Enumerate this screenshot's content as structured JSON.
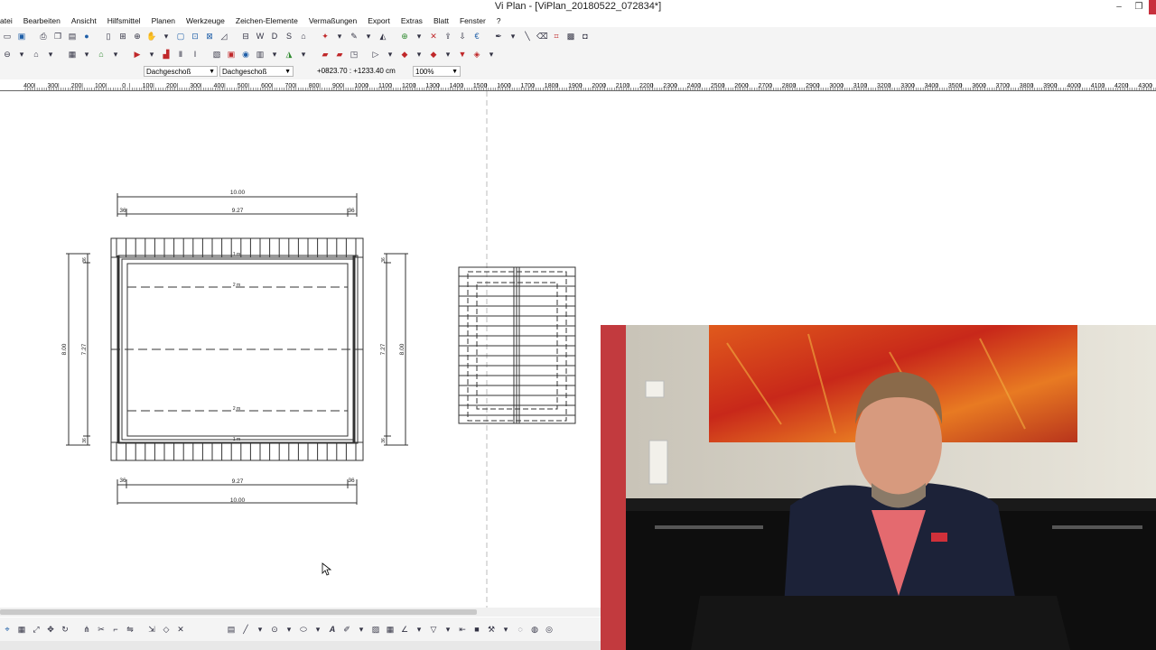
{
  "window": {
    "title": "Vi Plan - [ViPlan_20180522_072834*]",
    "minimize": "–",
    "restore": "❐",
    "close": "×"
  },
  "menu": [
    "atei",
    "Bearbeiten",
    "Ansicht",
    "Hilfsmittel",
    "Planen",
    "Werkzeuge",
    "Zeichen-Elemente",
    "Vermaßungen",
    "Export",
    "Extras",
    "Blatt",
    "Fenster",
    "?"
  ],
  "options": {
    "floor1": "Dachgeschoß",
    "floor2": "Dachgeschoß",
    "coordinates": "+0823.70 : +1233.40 cm",
    "zoom": "100%"
  },
  "ruler": {
    "labels": [
      "400",
      "300",
      "200",
      "100",
      "0",
      "100",
      "200",
      "300",
      "400",
      "500",
      "600",
      "700",
      "800",
      "900",
      "1000",
      "1100",
      "1200",
      "1300",
      "1400",
      "1500",
      "1600",
      "1700",
      "1800",
      "1900",
      "2000",
      "2100",
      "2200",
      "2300",
      "2400",
      "2500",
      "2600",
      "2700",
      "2800",
      "2900",
      "3000",
      "3100",
      "3200",
      "3300",
      "3400",
      "3500",
      "3600",
      "3700",
      "3800",
      "3900",
      "4000",
      "4100",
      "4200",
      "4300"
    ]
  },
  "drawing": {
    "top_dim_total": "10.00",
    "top_dim_inner": "9.27",
    "top_dim_left_small": "36",
    "top_dim_right_small": "36",
    "bottom_dim_inner": "9.27",
    "bottom_dim_total": "10.00",
    "bottom_dim_left_small": "36",
    "bottom_dim_right_small": "36",
    "left_dim_total": "8.00",
    "left_dim_inner": "7.27",
    "right_dim_inner": "7.27",
    "right_dim_total": "8.00",
    "side_small_top": "36",
    "side_small_bottom": "36",
    "upper_dash_label": "2 m",
    "lower_dash_label": "2 m",
    "bottom_inner_label": "1 m",
    "top_ridge_label": "1 m"
  },
  "colors": {
    "toolbar_bg": "#f4f4f4",
    "close_button": "#c8303d",
    "drawing_line": "#333333"
  }
}
